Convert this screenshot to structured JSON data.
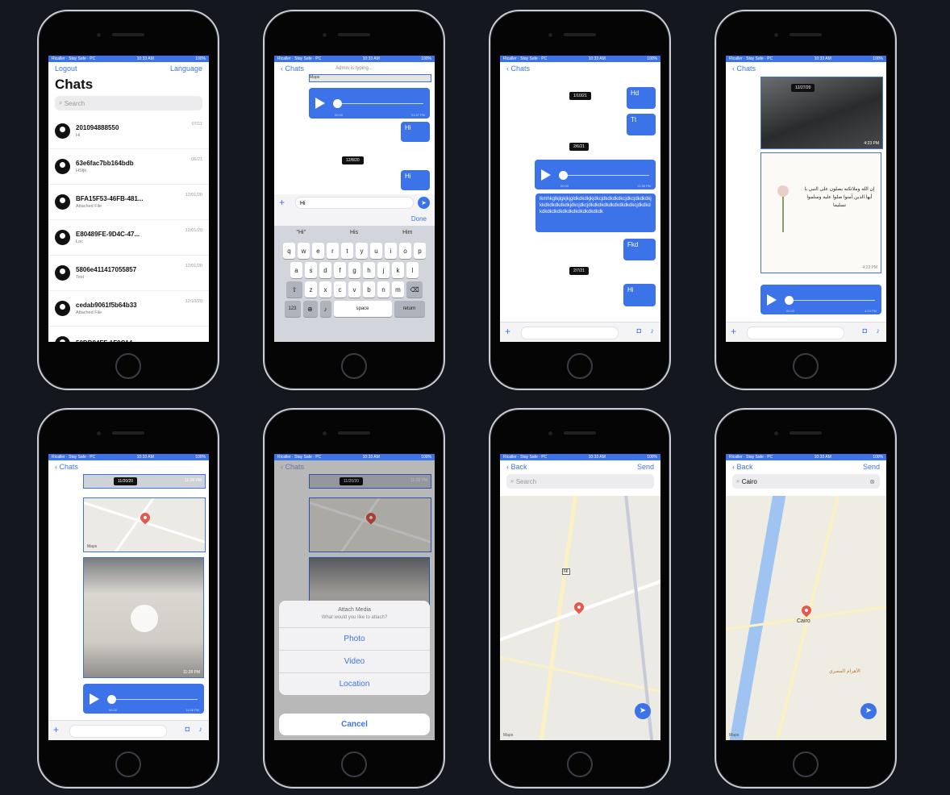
{
  "status": {
    "left": "Ricaller · Stay Safe · PC",
    "time": "10:33 AM",
    "battery": "100%"
  },
  "list": {
    "logout": "Logout",
    "language": "Language",
    "title": "Chats",
    "search_placeholder": "Search",
    "chats": [
      {
        "name": "201094888550",
        "last": "Hi",
        "date": "07/11"
      },
      {
        "name": "63e6fac7bb164bdb",
        "last": "HSfjk",
        "date": "06/21"
      },
      {
        "name": "BFA15F53-46FB-481...",
        "last": "Attached File",
        "date": "12/01/20"
      },
      {
        "name": "E80489FE-9D4C-47...",
        "last": "Loc",
        "date": "12/01/20"
      },
      {
        "name": "5806e411417055857",
        "last": "Test",
        "date": "12/01/20"
      },
      {
        "name": "cedab9061f5b64b33",
        "last": "Attached File",
        "date": "12/10/20"
      },
      {
        "name": "50DB84FF-1F0C14...",
        "last": "",
        "date": ""
      }
    ]
  },
  "chat_typing": {
    "back": "Chats",
    "status": "Admin is typing...",
    "pill": "12/8/20",
    "maps": "Maps",
    "bubble1": "Hi",
    "bubble2": "Hi",
    "input": "Hi",
    "done": "Done",
    "suggestions": [
      "\"Hi\"",
      "His",
      "Him"
    ],
    "rows": [
      [
        "q",
        "w",
        "e",
        "r",
        "t",
        "y",
        "u",
        "i",
        "o",
        "p"
      ],
      [
        "a",
        "s",
        "d",
        "f",
        "g",
        "h",
        "j",
        "k",
        "l"
      ],
      [
        "z",
        "x",
        "c",
        "v",
        "b",
        "n",
        "m"
      ]
    ],
    "k123": "123",
    "space": "space",
    "return": "return",
    "audio_start": "00:00",
    "audio_end": "01:37 PM"
  },
  "chat_text": {
    "back": "Chats",
    "pill1": "1/10/21",
    "pill2": "2/6/21",
    "pill3": "2/7/21",
    "b1": "Hd",
    "b2": "Tt",
    "long": "lkmhkglkjlgkjkjgldkdkdkjkjdkcjdkdkdkdkcjdkcjdkdkdkjkkdkdkdkdkdkjdkcjdkcjdkdkdkdkdkdkdkdkdkcjdkdkdkdkdkdkdkdkdkdkdkdkdkdkdk",
    "b3": "Fkd",
    "b4": "Hi",
    "audio_start": "00:00",
    "audio_end": "11:38 PM"
  },
  "chat_media": {
    "back": "Chats",
    "pill": "12/27/20",
    "photo_time": "4:23 PM",
    "quote": "إن الله وملائكته يصلون على النبي يا أيها الذين آمنوا صلوا عليه وسلموا تسليما",
    "quote_time": "4:23 PM",
    "audio_start": "00:00",
    "audio_end": "4:23 PM"
  },
  "chat_video": {
    "back": "Chats",
    "pill": "11/20/20",
    "pill_time": "11:28 PM",
    "maps": "Maps",
    "video_time": "11:28 PM",
    "audio_start": "00:00",
    "audio_end": "11:28 PM"
  },
  "chat_attach": {
    "back": "Chats",
    "pill": "11/20/20",
    "pill_time": "11:28 PM",
    "title": "Attach Media",
    "subtitle": "What would you like to attach?",
    "photo": "Photo",
    "video": "Video",
    "location": "Location",
    "cancel": "Cancel"
  },
  "map1": {
    "back": "Back",
    "send": "Send",
    "search_placeholder": "Search",
    "route": "66",
    "legal": "Maps"
  },
  "map2": {
    "back": "Back",
    "send": "Send",
    "search_value": "Cairo",
    "pin_label": "Cairo",
    "poi": "الأهرام المصري",
    "legal": "Maps"
  },
  "colors": {
    "accent": "#3c73e8",
    "background": "#14171e"
  }
}
